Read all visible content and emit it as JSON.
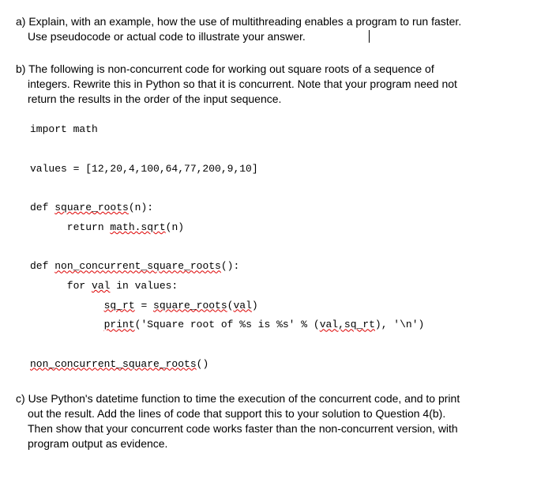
{
  "questions": {
    "a": {
      "label": "a)",
      "text1": "Explain, with an example, how the use of multithreading enables a program to run faster.",
      "text2": "Use pseudocode or actual code to illustrate your  answer."
    },
    "b": {
      "label": "b)",
      "text1": "The following is non-concurrent code for working out square roots of a sequence of",
      "text2": "integers. Rewrite this in Python so that it is concurrent. Note  that your program need not",
      "text3": "return the results in the order of the input sequence."
    },
    "c": {
      "label": "c)",
      "text1": "Use Python's datetime function to time the execution of the concurrent code, and to print",
      "text2": "out the result. Add the lines of code that support this to your solution to Question 4(b).",
      "text3": "Then show that your concurrent code works faster than the non-concurrent version, with",
      "text4": "program output as evidence."
    }
  },
  "code": {
    "l1": "import math",
    "l2": "values = [12,20,4,100,64,77,200,9,10]",
    "l3a": "def ",
    "l3b": "square_roots",
    "l3c": "(n):",
    "l4a": "      return ",
    "l4b": "math.sqrt",
    "l4c": "(n)",
    "l5a": "def ",
    "l5b": "non_concurrent_square_roots",
    "l5c": "():",
    "l6a": "      for ",
    "l6b": "val",
    "l6c": " in values:",
    "l7a": "            ",
    "l7b": "sq_rt",
    "l7c": " = ",
    "l7d": "square_roots",
    "l7e": "(",
    "l7f": "val",
    "l7g": ")",
    "l8a": "            ",
    "l8b": "print",
    "l8c": "('Square root of %s is %s' % (",
    "l8d": "val,sq_rt",
    "l8e": "), '\\n')",
    "l9a": "",
    "l9b": "non_concurrent_square_roots",
    "l9c": "()"
  }
}
